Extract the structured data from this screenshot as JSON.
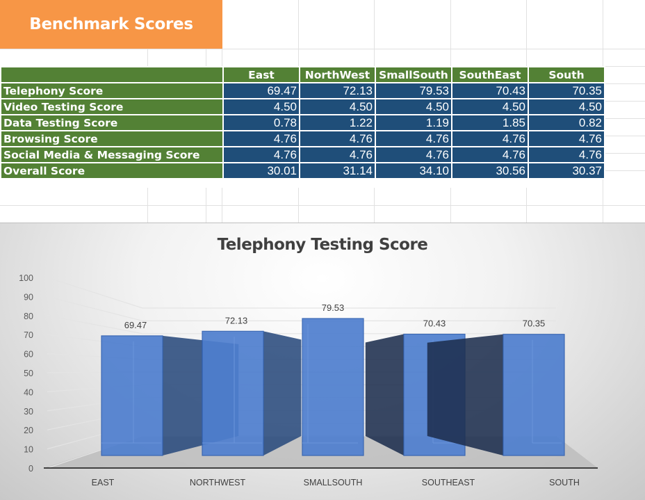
{
  "sheet": {
    "banner_title": "Benchmark Scores"
  },
  "table": {
    "columns": [
      "East",
      "NorthWest",
      "SmallSouth",
      "SouthEast",
      "South"
    ],
    "rows": [
      {
        "label": "Telephony Score",
        "values": [
          "69.47",
          "72.13",
          "79.53",
          "70.43",
          "70.35"
        ]
      },
      {
        "label": "Video Testing Score",
        "values": [
          "4.50",
          "4.50",
          "4.50",
          "4.50",
          "4.50"
        ]
      },
      {
        "label": "Data Testing Score",
        "values": [
          "0.78",
          "1.22",
          "1.19",
          "1.85",
          "0.82"
        ]
      },
      {
        "label": "Browsing Score",
        "values": [
          "4.76",
          "4.76",
          "4.76",
          "4.76",
          "4.76"
        ]
      },
      {
        "label": "Social Media & Messaging Score",
        "values": [
          "4.76",
          "4.76",
          "4.76",
          "4.76",
          "4.76"
        ]
      },
      {
        "label": "Overall Score",
        "values": [
          "30.01",
          "31.14",
          "34.10",
          "30.56",
          "30.37"
        ]
      }
    ]
  },
  "colors": {
    "banner": "#f79646",
    "header_green": "#538135",
    "value_blue": "#1f4e79",
    "bar_blue": "#4472c4"
  },
  "chart_data": {
    "type": "bar",
    "title": "Telephony Testing Score",
    "categories": [
      "EAST",
      "NORTHWEST",
      "SMALLSOUTH",
      "SOUTHEAST",
      "SOUTH"
    ],
    "values": [
      69.47,
      72.13,
      79.53,
      70.43,
      70.35
    ],
    "data_labels": [
      "69.47",
      "72.13",
      "79.53",
      "70.43",
      "70.35"
    ],
    "xlabel": "",
    "ylabel": "",
    "ylim": [
      0,
      100
    ],
    "yticks": [
      0,
      10,
      20,
      30,
      40,
      50,
      60,
      70,
      80,
      90,
      100
    ],
    "grid": true,
    "legend": "none",
    "style": "3d-column"
  }
}
